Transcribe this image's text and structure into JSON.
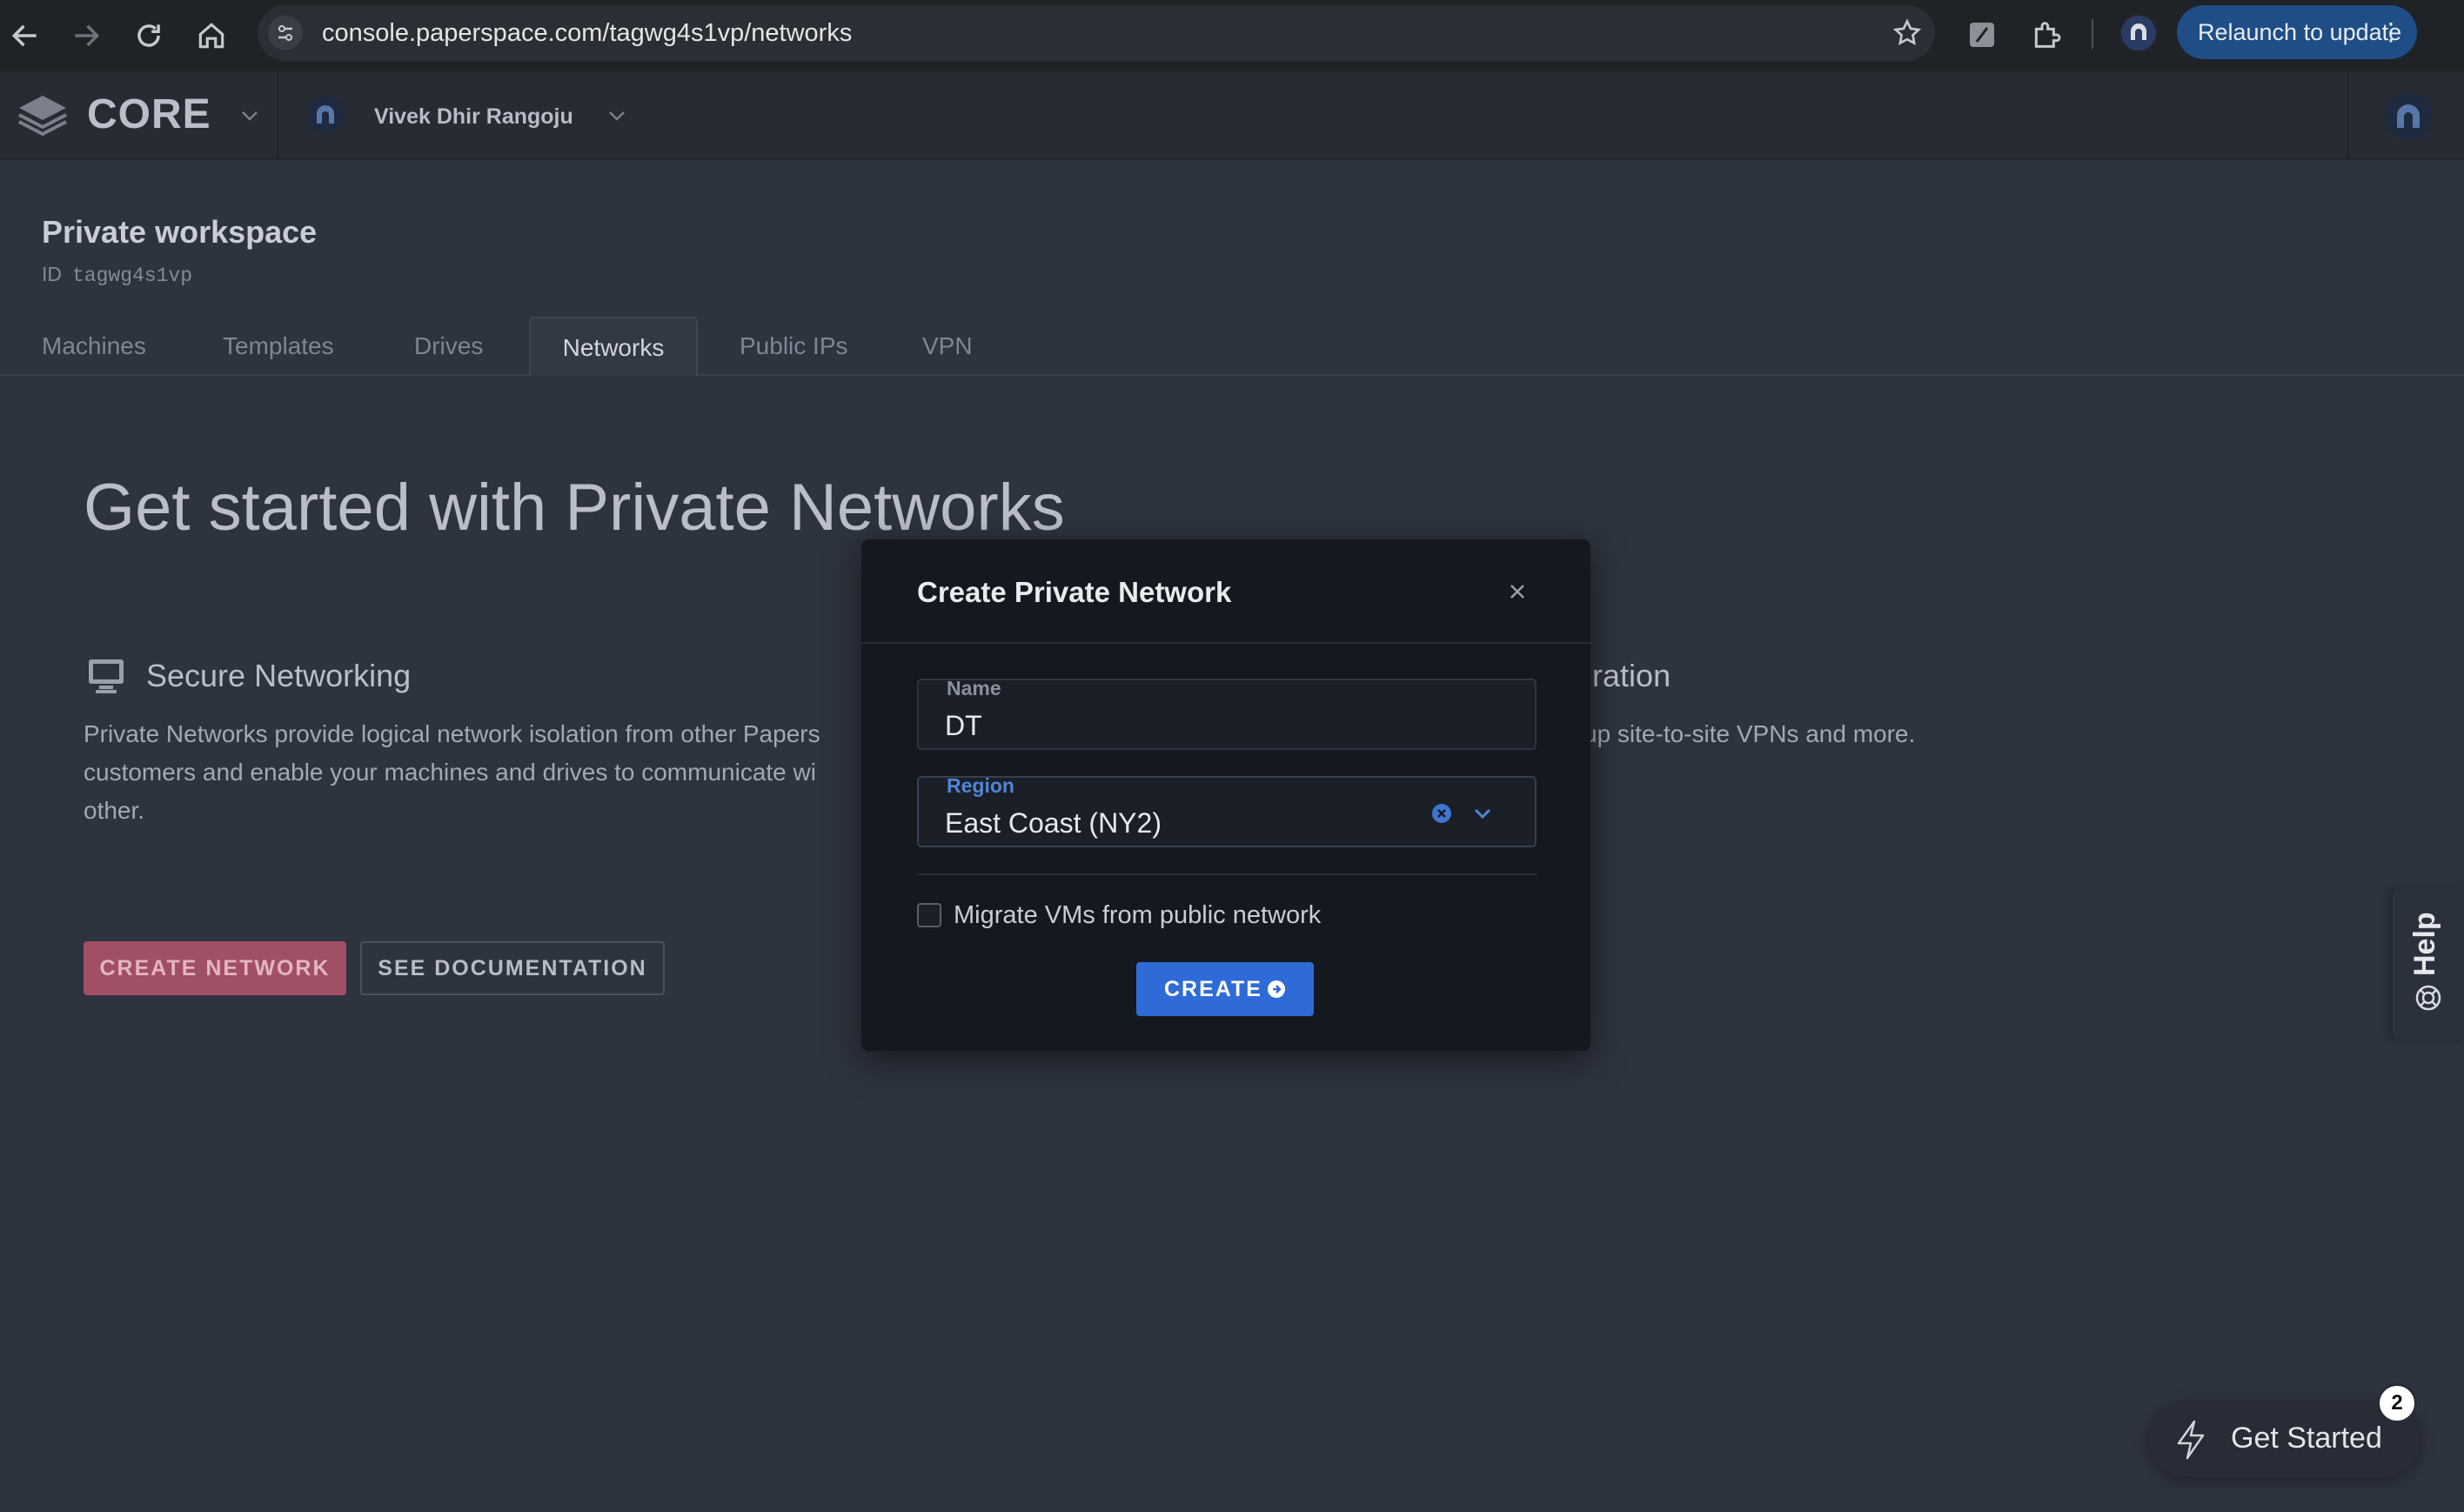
{
  "browser": {
    "url": "console.paperspace.com/tagwg4s1vp/networks",
    "relaunch_label": "Relaunch to update"
  },
  "app": {
    "brand": "CORE",
    "team_name": "Vivek Dhir Rangoju"
  },
  "workspace": {
    "title": "Private workspace",
    "id_label": "ID",
    "id_value": "tagwg4s1vp"
  },
  "tabs": [
    {
      "label": "Machines"
    },
    {
      "label": "Templates"
    },
    {
      "label": "Drives"
    },
    {
      "label": "Networks",
      "active": true
    },
    {
      "label": "Public IPs"
    },
    {
      "label": "VPN"
    }
  ],
  "page": {
    "hero": "Get started with Private Networks",
    "feature1_title": "Secure Networking",
    "feature1_desc": "Private Networks provide logical network isolation from other Papers customers and enable your machines and drives to communicate wi other.",
    "feature2_title": "egration",
    "feature2_desc": "up site-to-site VPNs and more.",
    "create_network_label": "CREATE NETWORK",
    "docs_label": "SEE DOCUMENTATION"
  },
  "help": {
    "label": "Help"
  },
  "get_started": {
    "label": "Get Started",
    "badge": "2"
  },
  "modal": {
    "title": "Create Private Network",
    "name_label": "Name",
    "name_value": "DT",
    "region_label": "Region",
    "region_value": "East Coast (NY2)",
    "migrate_label": "Migrate VMs from public network",
    "migrate_checked": false,
    "create_label": "CREATE"
  },
  "colors": {
    "accent": "#2f6bd6",
    "create_network_bg": "#a14f64",
    "relaunch_bg": "#1f4d86"
  }
}
